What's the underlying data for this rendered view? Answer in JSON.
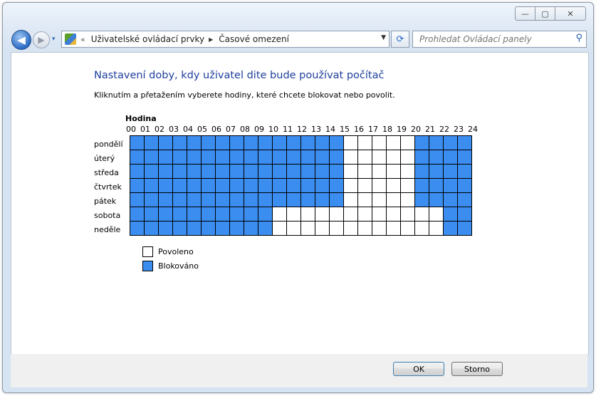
{
  "window": {
    "caption": {
      "minimize": "—",
      "maximize": "▢",
      "close": "✕"
    }
  },
  "nav": {
    "back_glyph": "◀",
    "forward_glyph": "▶",
    "history_glyph": "▾",
    "chevron": "«",
    "breadcrumb": [
      "Uživatelské ovládací prvky",
      "Časové omezení"
    ],
    "crumb_sep": "▶",
    "dropdown": "▼",
    "refresh_glyph": "⟳",
    "search_placeholder": "Prohledat Ovládací panely",
    "search_glyph": "⚲"
  },
  "main": {
    "title": "Nastavení doby, kdy uživatel dite bude používat počítač",
    "instructions": "Kliknutím a přetažením vyberete hodiny, které chcete blokovat nebo povolit.",
    "hour_label": "Hodina",
    "hours": [
      "00",
      "01",
      "02",
      "03",
      "04",
      "05",
      "06",
      "07",
      "08",
      "09",
      "10",
      "11",
      "12",
      "13",
      "14",
      "15",
      "16",
      "17",
      "18",
      "19",
      "20",
      "21",
      "22",
      "23",
      "24"
    ],
    "days": [
      "pondělí",
      "úterý",
      "středa",
      "čtvrtek",
      "pátek",
      "sobota",
      "neděle"
    ],
    "schedule": [
      "111111111111111000001111",
      "111111111111111000001111",
      "111111111111111000001111",
      "111111111111111000001111",
      "111111111111111000001111",
      "111111111100000000000011",
      "111111111100000000000011"
    ],
    "legend": [
      {
        "label": "Povoleno",
        "color": "#ffffff"
      },
      {
        "label": "Blokováno",
        "color": "#3b8df0"
      }
    ]
  },
  "footer": {
    "ok": "OK",
    "cancel": "Storno"
  }
}
